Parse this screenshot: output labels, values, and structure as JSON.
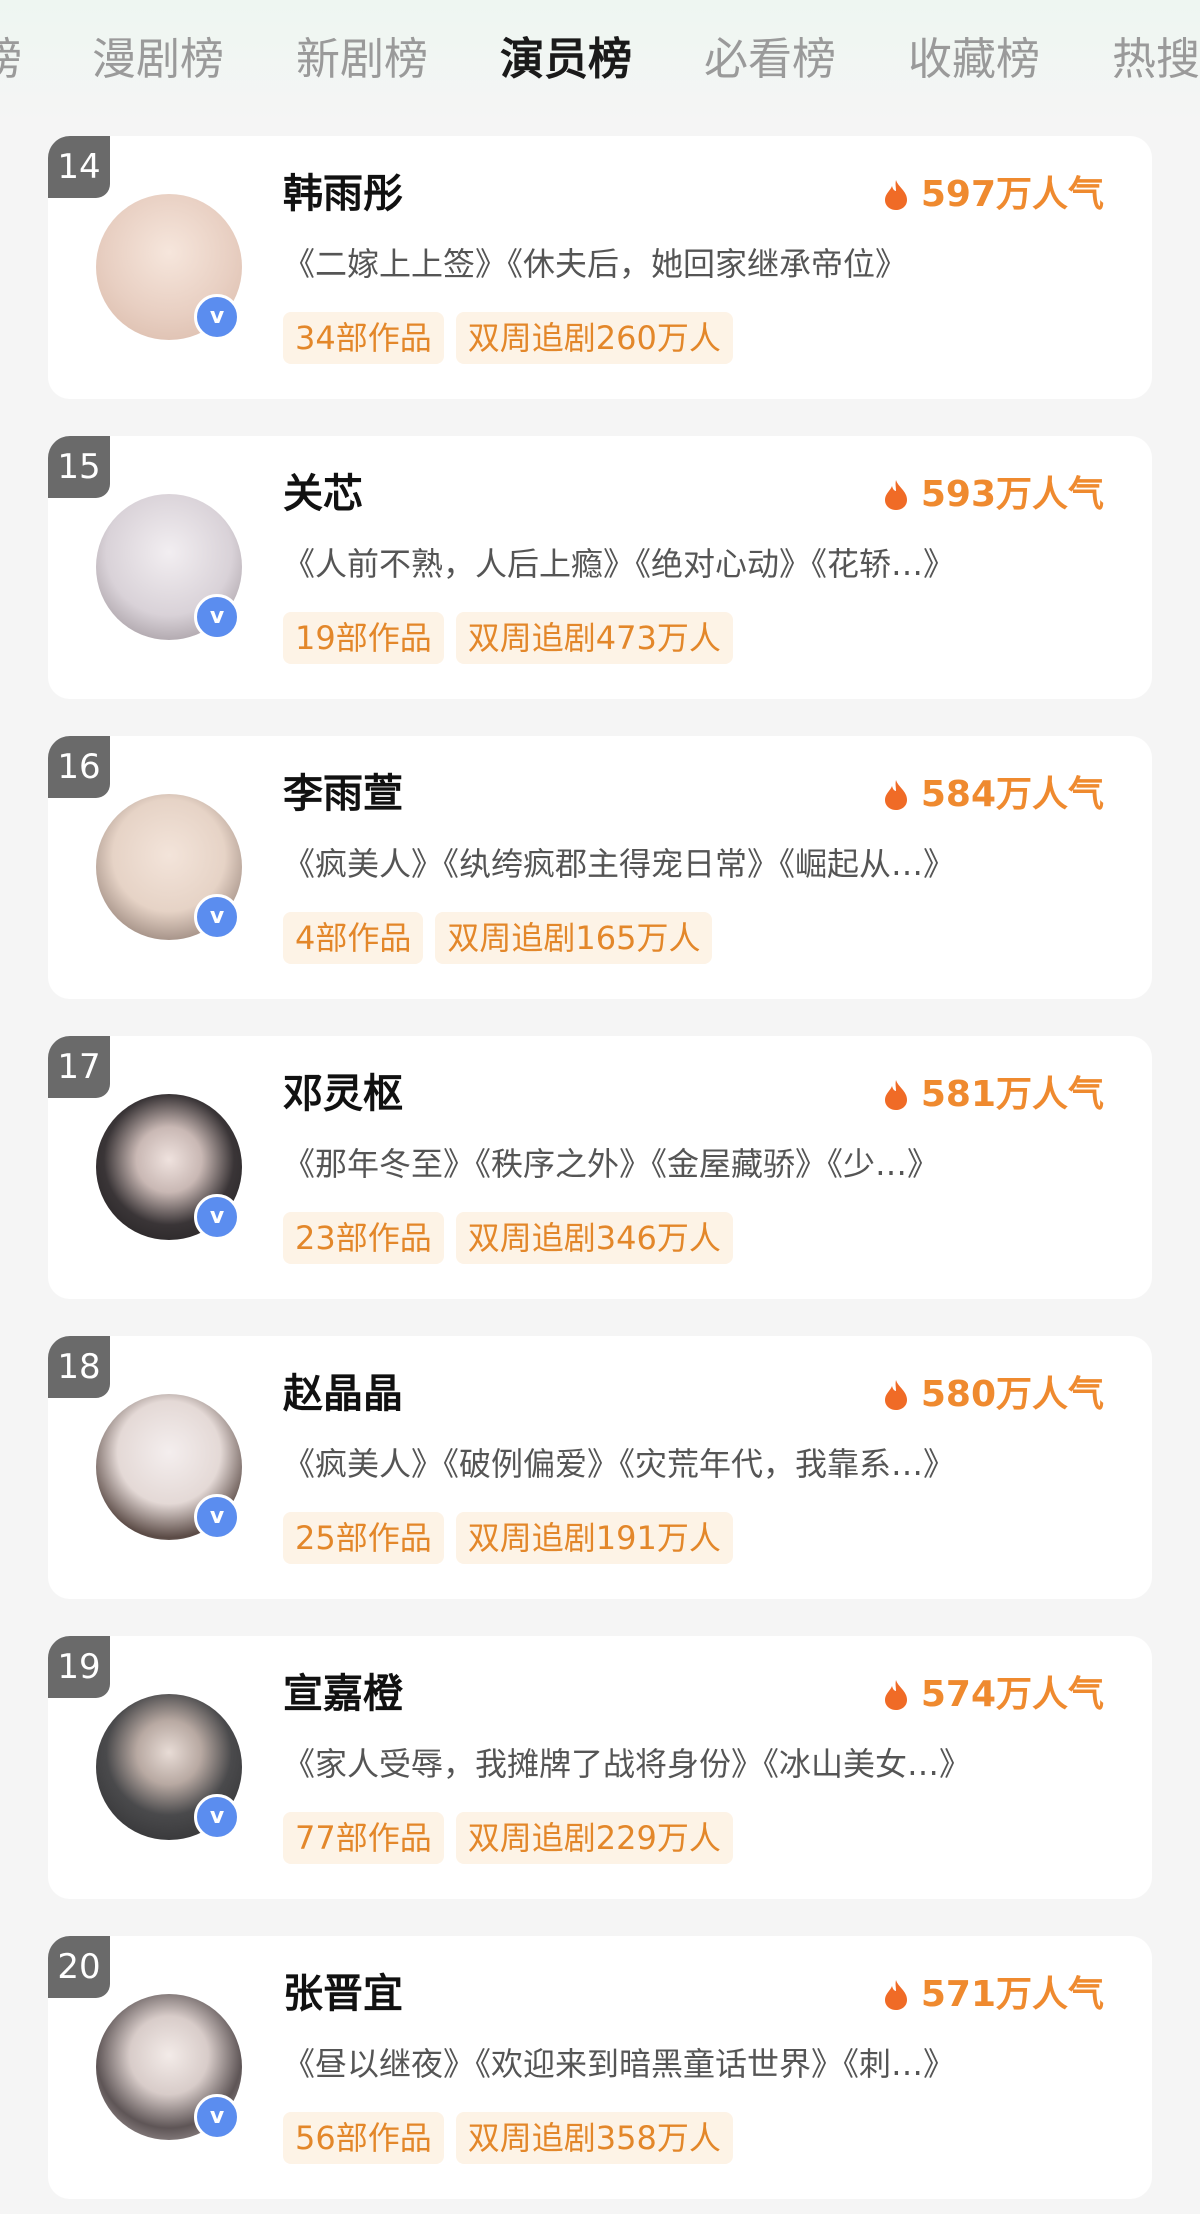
{
  "tabs": [
    {
      "label": "榜",
      "active": false
    },
    {
      "label": "漫剧榜",
      "active": false
    },
    {
      "label": "新剧榜",
      "active": false
    },
    {
      "label": "演员榜",
      "active": true
    },
    {
      "label": "必看榜",
      "active": false
    },
    {
      "label": "收藏榜",
      "active": false
    },
    {
      "label": "热搜",
      "active": false
    }
  ],
  "verified_mark": "v",
  "icons": {
    "heat": "flame-icon",
    "verified": "verified-badge-icon"
  },
  "colors": {
    "accent": "#ef8a2f",
    "tag_bg": "#fdf3e6",
    "verified": "#5b8def",
    "rank_bg": "#6a6a6a"
  },
  "actors": [
    {
      "rank": "14",
      "name": "韩雨彤",
      "popularity": "597万人气",
      "works": "《二嫁上上签》《休夫后，她回家继承帝位》",
      "work_count": "34部作品",
      "followers": "双周追剧260万人",
      "avatar_color": "#e8cfc2"
    },
    {
      "rank": "15",
      "name": "关芯",
      "popularity": "593万人气",
      "works": "《人前不熟，人后上瘾》《绝对心动》《花轿…》",
      "work_count": "19部作品",
      "followers": "双周追剧473万人",
      "avatar_color": "#d9d2d8"
    },
    {
      "rank": "16",
      "name": "李雨萱",
      "popularity": "584万人气",
      "works": "《疯美人》《纨绔疯郡主得宠日常》《崛起从…》",
      "work_count": "4部作品",
      "followers": "双周追剧165万人",
      "avatar_color": "#e6d3c6"
    },
    {
      "rank": "17",
      "name": "邓灵枢",
      "popularity": "581万人气",
      "works": "《那年冬至》《秩序之外》《金屋藏骄》《少…》",
      "work_count": "23部作品",
      "followers": "双周追剧346万人",
      "avatar_color": "#3a3537"
    },
    {
      "rank": "18",
      "name": "赵晶晶",
      "popularity": "580万人气",
      "works": "《疯美人》《破例偏爱》《灾荒年代，我靠系…》",
      "work_count": "25部作品",
      "followers": "双周追剧191万人",
      "avatar_color": "#ece6e6"
    },
    {
      "rank": "19",
      "name": "宣嘉橙",
      "popularity": "574万人气",
      "works": "《家人受辱，我摊牌了战将身份》《冰山美女…》",
      "work_count": "77部作品",
      "followers": "双周追剧229万人",
      "avatar_color": "#4a4a4c"
    },
    {
      "rank": "20",
      "name": "张晋宜",
      "popularity": "571万人气",
      "works": "《昼以继夜》《欢迎来到暗黑童话世界》《刺…》",
      "work_count": "56部作品",
      "followers": "双周追剧358万人",
      "avatar_color": "#c9bfbf"
    }
  ]
}
